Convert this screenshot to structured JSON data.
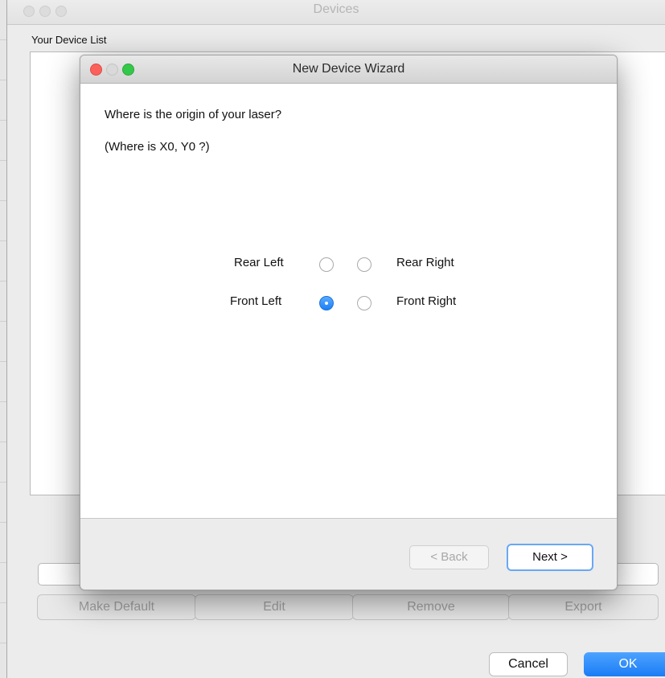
{
  "devices_window": {
    "title": "Devices",
    "list_label": "Your Device List",
    "actions": [
      "Make Default",
      "Edit",
      "Remove",
      "Export"
    ],
    "cancel_label": "Cancel",
    "ok_label": "OK"
  },
  "wizard": {
    "title": "New Device Wizard",
    "question": "Where is the origin of your laser?",
    "subquestion": "(Where is X0, Y0 ?)",
    "options": {
      "rear_left": "Rear Left",
      "rear_right": "Rear Right",
      "front_left": "Front Left",
      "front_right": "Front Right",
      "selected": "Front Left"
    },
    "back_label": "< Back",
    "next_label": "Next >"
  },
  "colors": {
    "accent": "#1a7cf5",
    "close": "#fc605b",
    "zoom": "#34c84a"
  }
}
